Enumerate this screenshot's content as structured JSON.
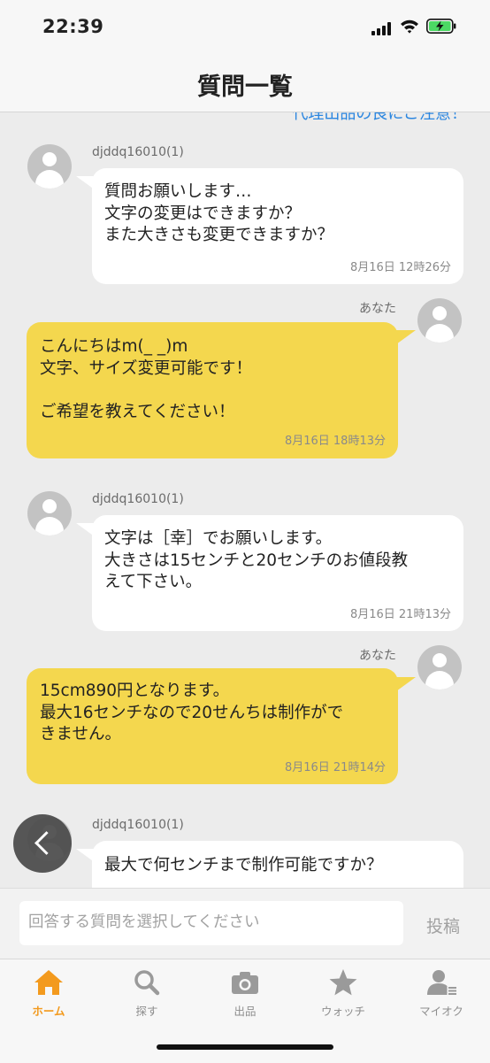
{
  "status": {
    "time": "22:39"
  },
  "header": {
    "title": "質問一覧"
  },
  "notice": {
    "text": "代理出品の良にご注意！"
  },
  "messages": [
    {
      "from": "djddq16010(1)",
      "text": "質問お願いします…\n文字の変更はできますか？\nまた大きさも変更できますか？",
      "time": "8月16日 12時26分"
    },
    {
      "from": "あなた",
      "text": "こんにちはm(_ _)m\n文字、サイズ変更可能です！\n\nご希望を教えてください！",
      "time": "8月16日 18時13分"
    },
    {
      "from": "djddq16010(1)",
      "text": "文字は［幸］でお願いします。\n大きさは15センチと20センチのお値段教\nえて下さい。",
      "time": "8月16日 21時13分"
    },
    {
      "from": "あなた",
      "text": "15cm890円となります。\n最大16センチなので20せんちは制作がで\nきません。",
      "time": "8月16日 21時14分"
    },
    {
      "from": "djddq16010(1)",
      "text": "最大で何センチまで制作可能ですか？",
      "time": ""
    }
  ],
  "reply": {
    "placeholder": "回答する質問を選択してください",
    "post_label": "投稿"
  },
  "tabs": [
    {
      "label": "ホーム",
      "icon": "home-icon",
      "active": true
    },
    {
      "label": "探す",
      "icon": "search-icon",
      "active": false
    },
    {
      "label": "出品",
      "icon": "camera-icon",
      "active": false
    },
    {
      "label": "ウォッチ",
      "icon": "star-icon",
      "active": false
    },
    {
      "label": "マイオク",
      "icon": "user-list-icon",
      "active": false
    }
  ],
  "colors": {
    "accent": "#f39a1e",
    "out_bubble": "#f4d74e",
    "in_bubble": "#ffffff",
    "link": "#2b86e0"
  }
}
